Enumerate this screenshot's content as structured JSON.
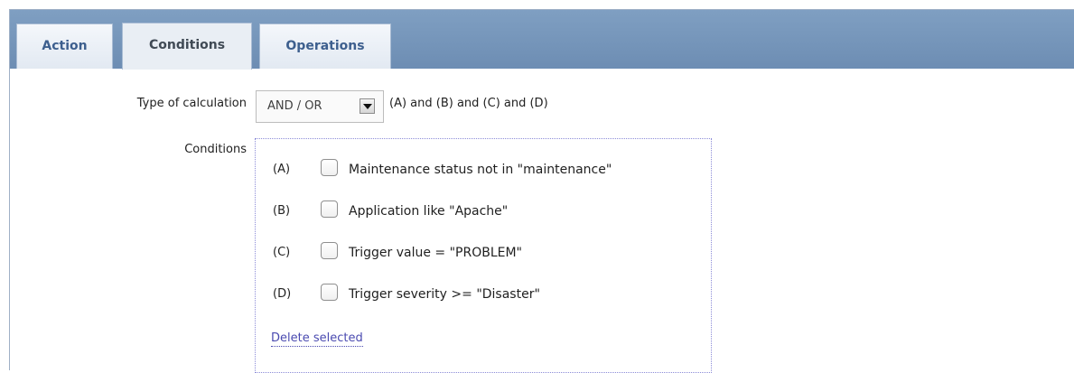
{
  "tabs": [
    {
      "label": "Action",
      "active": false
    },
    {
      "label": "Conditions",
      "active": true
    },
    {
      "label": "Operations",
      "active": false
    }
  ],
  "form": {
    "calc_label": "Type of calculation",
    "calc_value": "AND / OR",
    "formula": "(A) and (B) and (C) and (D)",
    "conditions_label": "Conditions",
    "conditions": [
      {
        "letter": "(A)",
        "text": "Maintenance status not in \"maintenance\"",
        "checked": false
      },
      {
        "letter": "(B)",
        "text": "Application like \"Apache\"",
        "checked": false
      },
      {
        "letter": "(C)",
        "text": "Trigger value = \"PROBLEM\"",
        "checked": false
      },
      {
        "letter": "(D)",
        "text": "Trigger severity >= \"Disaster\"",
        "checked": false
      }
    ],
    "delete_label": "Delete selected"
  },
  "colors": {
    "tabbar": "#7f9fc2",
    "tab_text": "#3d5f8e",
    "link": "#4a4ab0",
    "dotted_border": "#8d8dd8"
  },
  "icons": {
    "dropdown": "chevron-down-icon"
  }
}
